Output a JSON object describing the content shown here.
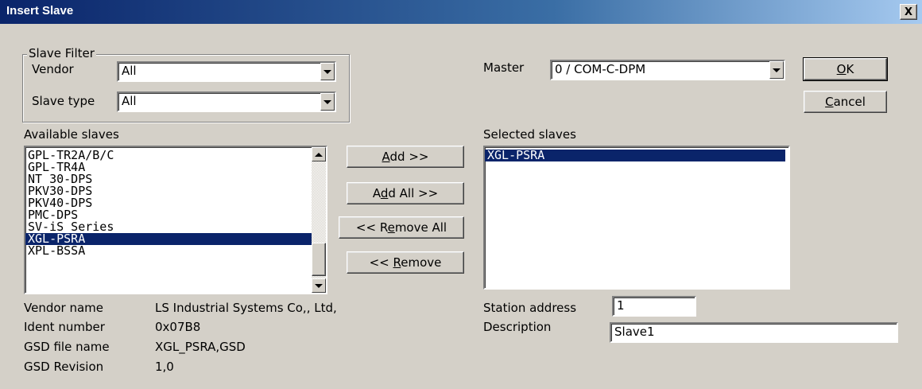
{
  "window": {
    "title": "Insert Slave",
    "close_glyph": "X"
  },
  "filter": {
    "legend": "Slave Filter",
    "vendor_label": "Vendor",
    "vendor_value": "All",
    "slave_type_label": "Slave type",
    "slave_type_value": "All"
  },
  "master": {
    "label": "Master",
    "value": "0 / COM-C-DPM"
  },
  "buttons": {
    "ok": {
      "pre": "",
      "ul": "O",
      "post": "K"
    },
    "cancel": {
      "pre": "",
      "ul": "C",
      "post": "ancel"
    },
    "add": {
      "pre": "",
      "ul": "A",
      "post": "dd >>"
    },
    "add_all": {
      "pre": "A",
      "ul": "d",
      "post": "d All >>"
    },
    "remove_all": {
      "pre": "<< R",
      "ul": "e",
      "post": "move All"
    },
    "remove": {
      "pre": "<< ",
      "ul": "R",
      "post": "emove"
    }
  },
  "available": {
    "label": "Available slaves",
    "items": [
      "GPL-TR2A/B/C",
      "GPL-TR4A",
      "NT 30-DPS",
      "PKV30-DPS",
      "PKV40-DPS",
      "PMC-DPS",
      "SV-iS Series",
      "XGL-PSRA",
      "XPL-BSSA"
    ],
    "selected_index": 7
  },
  "selected": {
    "label": "Selected slaves",
    "items": [
      "XGL-PSRA"
    ]
  },
  "info": {
    "vendor_name_label": "Vendor name",
    "vendor_name_value": "LS Industrial Systems Co,, Ltd,",
    "ident_number_label": "Ident number",
    "ident_number_value": "0x07B8",
    "gsd_file_label": "GSD file name",
    "gsd_file_value": "XGL_PSRA,GSD",
    "gsd_revision_label": "GSD Revision",
    "gsd_revision_value": "1,0"
  },
  "station": {
    "label": "Station address",
    "value": "1"
  },
  "description": {
    "label": "Description",
    "value": "Slave1"
  },
  "colors": {
    "selection": "#0a246a",
    "dialog_bg": "#d4d0c8",
    "title_start": "#0a246a",
    "title_end": "#a6caf0"
  }
}
